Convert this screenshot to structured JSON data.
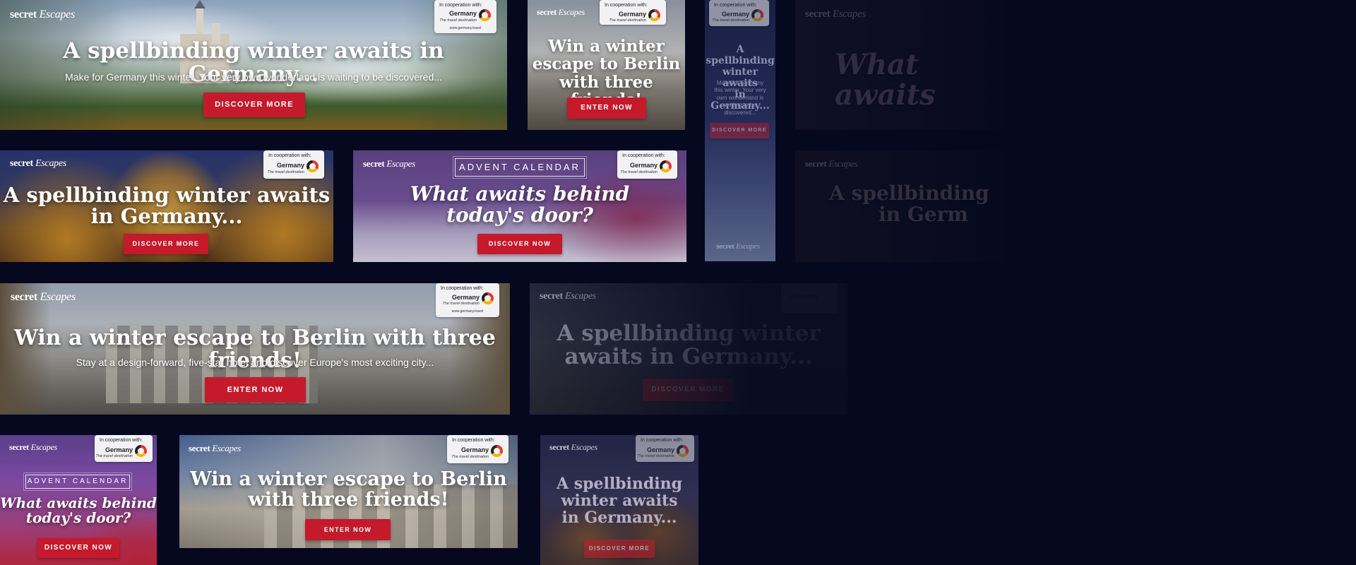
{
  "brand": {
    "logo_a": "secret",
    "logo_b": "Escapes"
  },
  "coop": {
    "label": "In cooperation with:",
    "name": "Germany",
    "tagline": "The travel destination",
    "url": "www.germany.travel"
  },
  "texts": {
    "winter_germany_ellipsis": "A spellbinding winter awaits in Germany...",
    "winter_germany_1": "A spellbinding winter awaits",
    "winter_germany_2": "in Germany...",
    "winter_germany_sq_1": "A spellbinding",
    "winter_germany_sq_2": "winter awaits",
    "winter_germany_sq_3": "in Germany...",
    "winter_germany_big_1": "A spellbinding winter",
    "winter_germany_big_2": "awaits in Germany...",
    "winter_germany_sky_1": "A spellbinding",
    "winter_germany_sky_2": "winter awaits",
    "winter_germany_sky_3": "in Germany...",
    "germany_sub": "Make for Germany this winter. Your very own wonderland is waiting to be discovered...",
    "sky_sub": "Make for Germany this winter. Your very own wonderland is waiting to be discovered...",
    "berlin_full": "Win a winter escape to Berlin with three friends!",
    "berlin_sub": "Stay at a design-forward, five-star hotel and discover Europe's most exciting city...",
    "berlin_l1": "Win a winter",
    "berlin_l2": "escape to Berlin",
    "berlin_l3": "with three friends!",
    "berlin_w1": "Win a winter escape to Berlin",
    "berlin_w2": "with three friends!",
    "advent": "ADVENT CALENDAR",
    "advent_q1": "What awaits behind",
    "advent_q2": "today's door?",
    "advent_faded": "What awaits",
    "advent_faded_2": "A spellbinding",
    "advent_faded_3": "in Germ"
  },
  "buttons": {
    "discover_more": "DISCOVER MORE",
    "discover_now": "DISCOVER NOW",
    "enter_now": "ENTER NOW"
  },
  "colors": {
    "background": "#05081f",
    "cta": "#c41a2b",
    "coop_badge": "#f2f2f4"
  }
}
